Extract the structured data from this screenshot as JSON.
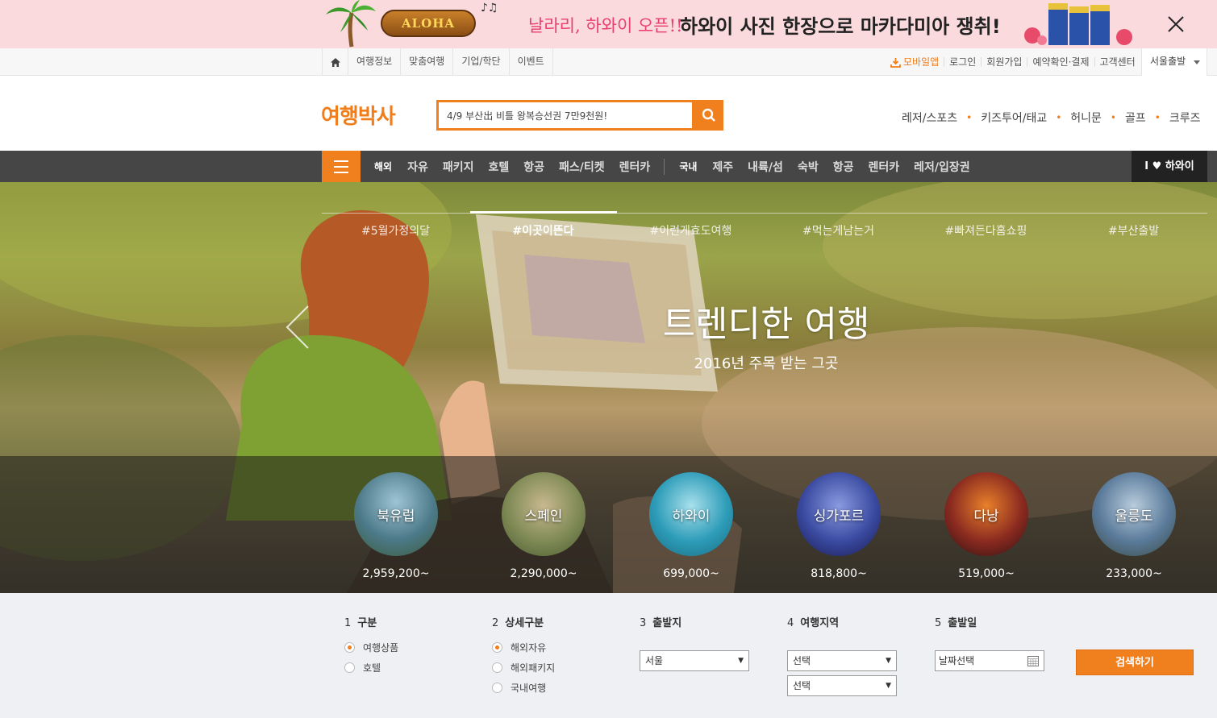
{
  "promo": {
    "badge": "ALOHA",
    "script_text": "날라리, 하와이 오픈!!",
    "headline": "하와이 사진 한장으로 마카다미아 쟁취!",
    "notes": "♪♫"
  },
  "util": {
    "left_items": [
      {
        "label": "여행정보"
      },
      {
        "label": "맞춤여행"
      },
      {
        "label": "기업/학단"
      },
      {
        "label": "이벤트"
      }
    ],
    "right_items": [
      {
        "label": "모바일앱"
      },
      {
        "label": "로그인"
      },
      {
        "label": "회원가입"
      },
      {
        "label": "예약확인·결제"
      },
      {
        "label": "고객센터"
      }
    ],
    "departure_select": "서울출발"
  },
  "header": {
    "logo": "여행박사",
    "search_value": "4/9 부산出 비틀 왕복승선권 7만9천원!",
    "links": [
      {
        "label": "레저/스포츠"
      },
      {
        "label": "키즈투어/태교"
      },
      {
        "label": "허니문"
      },
      {
        "label": "골프"
      },
      {
        "label": "크루즈"
      }
    ]
  },
  "nav": {
    "overseas_head": "해외",
    "overseas": [
      "자유",
      "패키지",
      "호텔",
      "항공",
      "패스/티켓",
      "렌터카"
    ],
    "domestic_head": "국내",
    "domestic": [
      "제주",
      "내륙/섬",
      "숙박",
      "항공",
      "렌터카",
      "레저/입장권"
    ],
    "hawaii": "I ♥ 하와이"
  },
  "hero": {
    "hashtags": [
      "#5월가정의달",
      "#이곳이뜬다",
      "#이런게효도여행",
      "#먹는게남는거",
      "#빠져든다홈쇼핑",
      "#부산출발"
    ],
    "active_index": 1,
    "title": "트렌디한 여행",
    "subtitle": "2016년 주목 받는 그곳"
  },
  "destinations": [
    {
      "name": "북유럽",
      "price": "2,959,200~",
      "color": "#4d7a8a"
    },
    {
      "name": "스페인",
      "price": "2,290,000~",
      "color": "#7f8a55"
    },
    {
      "name": "하와이",
      "price": "699,000~",
      "color": "#2d9cb8"
    },
    {
      "name": "싱가포르",
      "price": "818,800~",
      "color": "#3a4aa0"
    },
    {
      "name": "다낭",
      "price": "519,000~",
      "color": "#8a2a20"
    },
    {
      "name": "울릉도",
      "price": "233,000~",
      "color": "#5a7a9a"
    }
  ],
  "form": {
    "steps": [
      {
        "num": "1",
        "label": "구분"
      },
      {
        "num": "2",
        "label": "상세구분"
      },
      {
        "num": "3",
        "label": "출발지"
      },
      {
        "num": "4",
        "label": "여행지역"
      },
      {
        "num": "5",
        "label": "출발일"
      }
    ],
    "type_options": [
      "여행상품",
      "호텔"
    ],
    "detail_options": [
      "해외자유",
      "해외패키지",
      "국내여행"
    ],
    "departure_value": "서울",
    "region_value_1": "선택",
    "region_value_2": "선택",
    "date_value": "날짜선택",
    "submit": "검색하기"
  },
  "colors": {
    "accent": "#f0801e",
    "nav_bg": "#464646",
    "promo_bg": "#fadadd"
  }
}
